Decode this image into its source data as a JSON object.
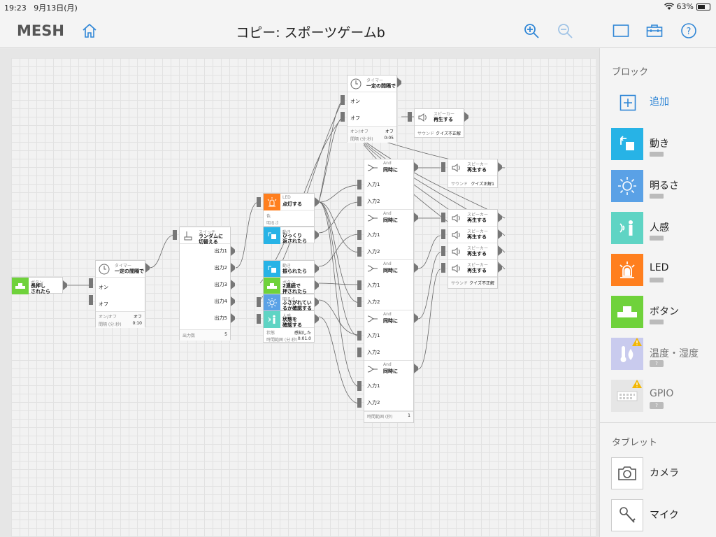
{
  "status": {
    "time": "19:23",
    "date": "9月13日(月)",
    "battery": "63%",
    "battery_level": 0.63
  },
  "header": {
    "logo": "MESH",
    "title": "コピー: スポーツゲームb"
  },
  "blocks": {
    "button1": {
      "category": "ボタン",
      "action": "長押し\nされたら"
    },
    "timer1": {
      "category": "タイマー",
      "action": "一定の間隔で",
      "in_on": "オン",
      "in_off": "オフ",
      "onoff_label": "オン/オフ",
      "onoff_value": "オフ",
      "interval_label": "間隔 (分:秒)",
      "interval_value": "0:10"
    },
    "switch": {
      "category": "スイッチ",
      "action": "ランダムに\n切替える",
      "outputs": [
        "出力1",
        "出力2",
        "出力3",
        "出力4",
        "出力5"
      ],
      "count_label": "出力数",
      "count_value": "5"
    },
    "led": {
      "category": "LED",
      "action": "点灯する",
      "color_label": "色",
      "bright_label": "明るさ"
    },
    "move1": {
      "category": "動き",
      "action": "ひっくり\n返されたら"
    },
    "move2": {
      "category": "動き",
      "action": "振られたら"
    },
    "button2": {
      "category": "ボタン",
      "action": "2連続で\n押されたら"
    },
    "bright": {
      "category": "明るさ",
      "action": "ふさがれてい\nるか確認する"
    },
    "human": {
      "category": "人感",
      "action": "状態を\n確認する",
      "state_label": "状態",
      "state_value": "感知した",
      "time_label": "時間範囲 (分:秒)",
      "time_value": "0:01.0"
    },
    "timer2": {
      "category": "タイマー",
      "action": "一定の間隔で",
      "in_on": "オン",
      "in_off": "オフ",
      "onoff_label": "オン/オフ",
      "onoff_value": "オフ",
      "interval_label": "間隔 (分:秒)",
      "interval_value": "0:05"
    },
    "speaker_top": {
      "category": "スピーカー",
      "action": "再生する",
      "sound_label": "サウンド",
      "sound_value": "クイズ不正解"
    },
    "and": {
      "category": "And",
      "action": "同時に",
      "in1": "入力1",
      "in2": "入力2",
      "time_label": "時間範囲 (秒)",
      "time_value": "1"
    },
    "speaker_a": {
      "category": "スピーカー",
      "action": "再生する",
      "sound_label": "サウンド",
      "sound_value": "クイズ正解1"
    },
    "speaker_b": {
      "category": "スピーカー",
      "action": "再生する",
      "sound_label": "サウンド",
      "sound_value": "クイズ不正解"
    }
  },
  "panel": {
    "block_section": "ブロック",
    "add_label": "追加",
    "items": [
      {
        "label": "動き",
        "color": "#27b3e6"
      },
      {
        "label": "明るさ",
        "color": "#5aa1e6"
      },
      {
        "label": "人感",
        "color": "#5fd4c4"
      },
      {
        "label": "LED",
        "color": "#ff7f1e"
      },
      {
        "label": "ボタン",
        "color": "#6fd23b"
      },
      {
        "label": "温度・湿度",
        "color": "#c9cbee",
        "badge": "?"
      },
      {
        "label": "GPIO",
        "color": "#e6e6e6",
        "badge": "?"
      }
    ],
    "tablet_section": "タブレット",
    "tablet_items": [
      {
        "label": "カメラ"
      },
      {
        "label": "マイク"
      }
    ]
  }
}
